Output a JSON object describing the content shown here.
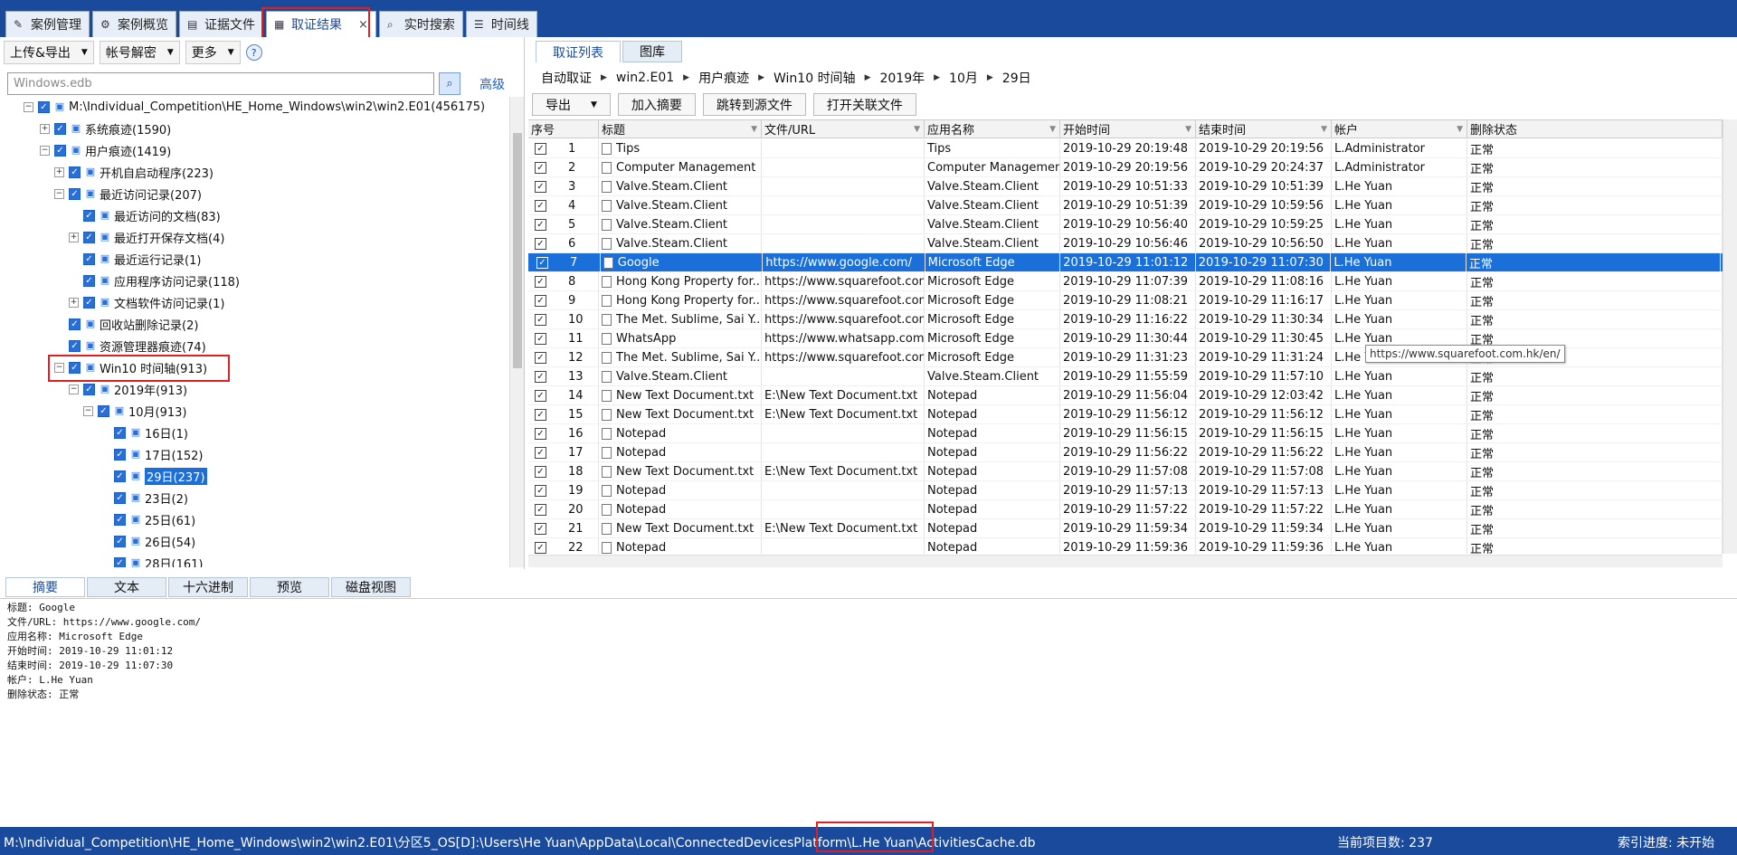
{
  "top_tabs": [
    {
      "label": "案例管理",
      "icon": "edit-icon"
    },
    {
      "label": "案例概览",
      "icon": "gear-icon"
    },
    {
      "label": "证据文件",
      "icon": "file-icon"
    },
    {
      "label": "取证结果",
      "icon": "result-icon",
      "active": true,
      "close": "×"
    },
    {
      "label": "实时搜索",
      "icon": "search-icon"
    },
    {
      "label": "时间线",
      "icon": "timeline-icon"
    }
  ],
  "left_toolbar": {
    "upload": "上传&导出",
    "account": "帐号解密",
    "more": "更多",
    "help": "?"
  },
  "search": {
    "value": "Windows.edb",
    "advanced": "高级"
  },
  "tree": [
    {
      "label": "M:\\Individual_Competition\\HE_Home_Windows\\win2\\win2.E01(456175)",
      "level": 0,
      "exp": "-"
    },
    {
      "label": "系统痕迹(1590)",
      "level": 1,
      "exp": "+"
    },
    {
      "label": "用户痕迹(1419)",
      "level": 1,
      "exp": "-"
    },
    {
      "label": "开机自启动程序(223)",
      "level": 2,
      "exp": "+"
    },
    {
      "label": "最近访问记录(207)",
      "level": 2,
      "exp": "-"
    },
    {
      "label": "最近访问的文档(83)",
      "level": 3,
      "exp": ""
    },
    {
      "label": "最近打开保存文档(4)",
      "level": 3,
      "exp": "+"
    },
    {
      "label": "最近运行记录(1)",
      "level": 3,
      "exp": ""
    },
    {
      "label": "应用程序访问记录(118)",
      "level": 3,
      "exp": ""
    },
    {
      "label": "文档软件访问记录(1)",
      "level": 3,
      "exp": "+"
    },
    {
      "label": "回收站删除记录(2)",
      "level": 2,
      "exp": ""
    },
    {
      "label": "资源管理器痕迹(74)",
      "level": 2,
      "exp": ""
    },
    {
      "label": "Win10 时间轴(913)",
      "level": 2,
      "exp": "-"
    },
    {
      "label": "2019年(913)",
      "level": 3,
      "exp": "-"
    },
    {
      "label": "10月(913)",
      "level": 4,
      "exp": "-"
    },
    {
      "label": "16日(1)",
      "level": 5,
      "exp": ""
    },
    {
      "label": "17日(152)",
      "level": 5,
      "exp": ""
    },
    {
      "label": "29日(237)",
      "level": 5,
      "exp": "",
      "selected": true
    },
    {
      "label": "23日(2)",
      "level": 5,
      "exp": ""
    },
    {
      "label": "25日(61)",
      "level": 5,
      "exp": ""
    },
    {
      "label": "26日(54)",
      "level": 5,
      "exp": ""
    },
    {
      "label": "28日(161)",
      "level": 5,
      "exp": ""
    }
  ],
  "right_tabs": [
    "取证列表",
    "图库"
  ],
  "breadcrumb": [
    "自动取证",
    "win2.E01",
    "用户痕迹",
    "Win10 时间轴",
    "2019年",
    "10月",
    "29日"
  ],
  "right_toolbar": {
    "export": "导出",
    "add_summary": "加入摘要",
    "jump_source": "跳转到源文件",
    "open_related": "打开关联文件"
  },
  "columns": [
    "序号",
    "标题",
    "文件/URL",
    "应用名称",
    "开始时间",
    "结束时间",
    "帐户",
    "删除状态"
  ],
  "rows": [
    [
      "1",
      "Tips",
      "",
      "Tips",
      "2019-10-29 20:19:48",
      "2019-10-29 20:19:56",
      "L.Administrator",
      "正常"
    ],
    [
      "2",
      "Computer Management",
      "",
      "Computer Management",
      "2019-10-29 20:19:56",
      "2019-10-29 20:24:37",
      "L.Administrator",
      "正常"
    ],
    [
      "3",
      "Valve.Steam.Client",
      "",
      "Valve.Steam.Client",
      "2019-10-29 10:51:33",
      "2019-10-29 10:51:39",
      "L.He Yuan",
      "正常"
    ],
    [
      "4",
      "Valve.Steam.Client",
      "",
      "Valve.Steam.Client",
      "2019-10-29 10:51:39",
      "2019-10-29 10:59:56",
      "L.He Yuan",
      "正常"
    ],
    [
      "5",
      "Valve.Steam.Client",
      "",
      "Valve.Steam.Client",
      "2019-10-29 10:56:40",
      "2019-10-29 10:59:25",
      "L.He Yuan",
      "正常"
    ],
    [
      "6",
      "Valve.Steam.Client",
      "",
      "Valve.Steam.Client",
      "2019-10-29 10:56:46",
      "2019-10-29 10:56:50",
      "L.He Yuan",
      "正常"
    ],
    [
      "7",
      "Google",
      "https://www.google.com/",
      "Microsoft Edge",
      "2019-10-29 11:01:12",
      "2019-10-29 11:07:30",
      "L.He Yuan",
      "正常"
    ],
    [
      "8",
      "Hong Kong Property for...",
      "https://www.squarefoot.com...",
      "Microsoft Edge",
      "2019-10-29 11:07:39",
      "2019-10-29 11:08:16",
      "L.He Yuan",
      "正常"
    ],
    [
      "9",
      "Hong Kong Property for...",
      "https://www.squarefoot.com...",
      "Microsoft Edge",
      "2019-10-29 11:08:21",
      "2019-10-29 11:16:17",
      "L.He Yuan",
      "正常"
    ],
    [
      "10",
      "The Met. Sublime, Sai Y...",
      "https://www.squarefoot.com...",
      "Microsoft Edge",
      "2019-10-29 11:16:22",
      "2019-10-29 11:30:34",
      "L.He Yuan",
      "正常"
    ],
    [
      "11",
      "WhatsApp",
      "https://www.whatsapp.com/",
      "Microsoft Edge",
      "2019-10-29 11:30:44",
      "2019-10-29 11:30:45",
      "L.He Yuan",
      "正常"
    ],
    [
      "12",
      "The Met. Sublime, Sai Y...",
      "https://www.squarefoot.com...",
      "Microsoft Edge",
      "2019-10-29 11:31:23",
      "2019-10-29 11:31:24",
      "L.He Yuan",
      "正常"
    ],
    [
      "13",
      "Valve.Steam.Client",
      "",
      "Valve.Steam.Client",
      "2019-10-29 11:55:59",
      "2019-10-29 11:57:10",
      "L.He Yuan",
      "正常"
    ],
    [
      "14",
      "New Text Document.txt",
      "E:\\New Text Document.txt",
      "Notepad",
      "2019-10-29 11:56:04",
      "2019-10-29 12:03:42",
      "L.He Yuan",
      "正常"
    ],
    [
      "15",
      "New Text Document.txt",
      "E:\\New Text Document.txt",
      "Notepad",
      "2019-10-29 11:56:12",
      "2019-10-29 11:56:12",
      "L.He Yuan",
      "正常"
    ],
    [
      "16",
      "Notepad",
      "",
      "Notepad",
      "2019-10-29 11:56:15",
      "2019-10-29 11:56:15",
      "L.He Yuan",
      "正常"
    ],
    [
      "17",
      "Notepad",
      "",
      "Notepad",
      "2019-10-29 11:56:22",
      "2019-10-29 11:56:22",
      "L.He Yuan",
      "正常"
    ],
    [
      "18",
      "New Text Document.txt",
      "E:\\New Text Document.txt",
      "Notepad",
      "2019-10-29 11:57:08",
      "2019-10-29 11:57:08",
      "L.He Yuan",
      "正常"
    ],
    [
      "19",
      "Notepad",
      "",
      "Notepad",
      "2019-10-29 11:57:13",
      "2019-10-29 11:57:13",
      "L.He Yuan",
      "正常"
    ],
    [
      "20",
      "Notepad",
      "",
      "Notepad",
      "2019-10-29 11:57:22",
      "2019-10-29 11:57:22",
      "L.He Yuan",
      "正常"
    ],
    [
      "21",
      "New Text Document.txt",
      "E:\\New Text Document.txt",
      "Notepad",
      "2019-10-29 11:59:34",
      "2019-10-29 11:59:34",
      "L.He Yuan",
      "正常"
    ],
    [
      "22",
      "Notepad",
      "",
      "Notepad",
      "2019-10-29 11:59:36",
      "2019-10-29 11:59:36",
      "L.He Yuan",
      "正常"
    ]
  ],
  "selected_row": 6,
  "tooltip": "https://www.squarefoot.com.hk/en/",
  "bottom_tabs": [
    "摘要",
    "文本",
    "十六进制",
    "预览",
    "磁盘视图"
  ],
  "detail_lines": [
    "标题: Google",
    "文件/URL: https://www.google.com/",
    "应用名称: Microsoft Edge",
    "开始时间: 2019-10-29 11:01:12",
    "结束时间: 2019-10-29 11:07:30",
    "帐户: L.He Yuan",
    "删除状态: 正常"
  ],
  "status": {
    "path": "M:\\Individual_Competition\\HE_Home_Windows\\win2\\win2.E01\\分区5_OS[D]:\\Users\\He Yuan\\AppData\\Local\\ConnectedDevicesPlatform\\L.He Yuan\\ActivitiesCache.db",
    "count": "当前项目数: 237",
    "index": "索引进度: 未开始"
  },
  "colors": {
    "accent": "#1a4a9c",
    "selection": "#1a6fd8",
    "highlight_box": "#e02020"
  }
}
